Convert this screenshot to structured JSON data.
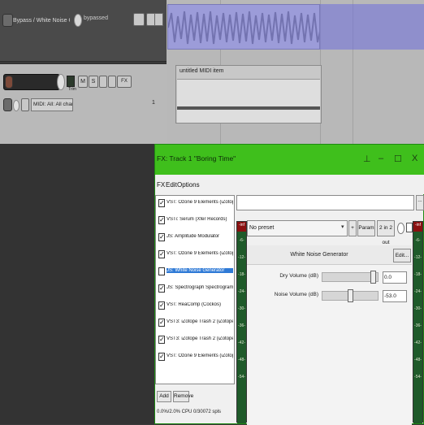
{
  "envelope": {
    "name": "Bypass / White Noise Generator",
    "bypassed_label": "bypassed"
  },
  "midi_item": {
    "name": "untitled MIDI item"
  },
  "track": {
    "buttons": {
      "mute": "M",
      "solo": "S",
      "fx": "FX"
    },
    "input_label": "MIDI: All: All channels",
    "number": "1",
    "trim_label": "Trim"
  },
  "fx_window": {
    "title": "FX: Track 1 \"Boring Time\"",
    "pin_glyph": "⊥",
    "min_glyph": "–",
    "max_glyph": "☐",
    "close_glyph": "X",
    "menu": [
      "FX",
      "Edit",
      "Options"
    ],
    "fx_chain": [
      {
        "name": "VST: Ozone 9 Elements (iZotope, Inc.)",
        "checked": true,
        "selected": false
      },
      {
        "name": "VSTi: Serum (Xfer Records)",
        "checked": true,
        "selected": false
      },
      {
        "name": "JS: Amplitude Modulator",
        "checked": true,
        "selected": false
      },
      {
        "name": "VST: Ozone 9 Elements (iZotope, Inc.)",
        "checked": true,
        "selected": false
      },
      {
        "name": "JS: White Noise Generator",
        "checked": false,
        "selected": true
      },
      {
        "name": "JS: Spectrograph Spectrogram Meter (C...",
        "checked": true,
        "selected": false
      },
      {
        "name": "VST: ReaComp (Cockos)",
        "checked": true,
        "selected": false
      },
      {
        "name": "VST3: iZotope Trash 2 (iZotope, Inc.)",
        "checked": true,
        "selected": false
      },
      {
        "name": "VST3: iZotope Trash 2 (iZotope, Inc.)",
        "checked": true,
        "selected": false
      },
      {
        "name": "VST: Ozone 9 Elements (iZotope, Inc.)",
        "checked": true,
        "selected": false
      }
    ],
    "add_label": "Add",
    "remove_label": "Remove",
    "cpu_label": "0.0%/2.0% CPU 0/30072 spls",
    "search_btn": "...",
    "preset": "No preset",
    "plus_label": "+",
    "param_label": "Param",
    "io_label": "2 in 2 out",
    "plugin_name": "White Noise Generator",
    "edit_label": "Edit...",
    "params": [
      {
        "label": "Dry Volume (dB)",
        "value": "0.0",
        "position": 0.96
      },
      {
        "label": "Noise Volume (dB)",
        "value": "-53.0",
        "position": 0.5
      }
    ],
    "meter_top": "-inf",
    "meter_ticks": [
      "-6-",
      "-12-",
      "-18-",
      "-24-",
      "-30-",
      "-36-",
      "-42-",
      "-48-",
      "-54-"
    ]
  }
}
